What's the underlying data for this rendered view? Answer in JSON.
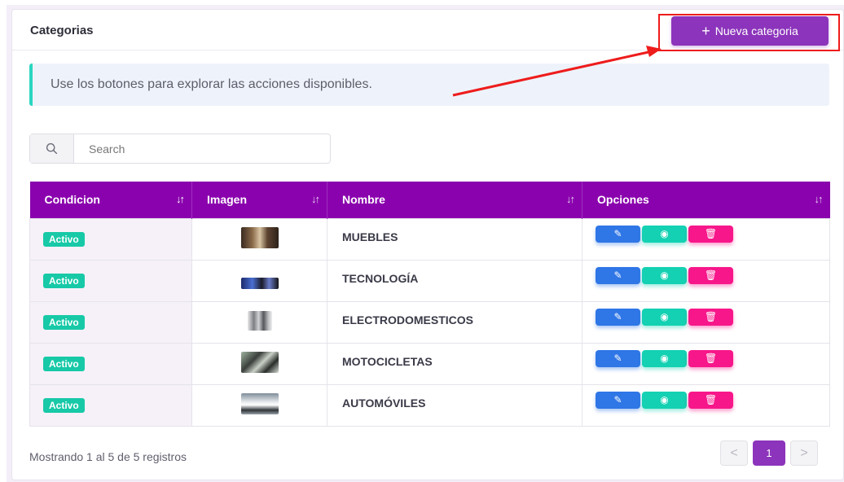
{
  "header": {
    "title": "Categorias",
    "new_button_label": "Nueva categoria",
    "new_button_icon": "plus-icon"
  },
  "alert": {
    "text": "Use los botones para explorar las acciones disponibles."
  },
  "search": {
    "placeholder": "Search",
    "icon": "search-icon"
  },
  "table": {
    "columns": [
      "Condicion",
      "Imagen",
      "Nombre",
      "Opciones"
    ],
    "rows": [
      {
        "status": "Activo",
        "name": "MUEBLES",
        "image": "furniture-thumbnail"
      },
      {
        "status": "Activo",
        "name": "TECNOLOGÍA",
        "image": "technology-thumbnail"
      },
      {
        "status": "Activo",
        "name": "ELECTRODOMESTICOS",
        "image": "appliances-thumbnail"
      },
      {
        "status": "Activo",
        "name": "MOTOCICLETAS",
        "image": "motorcycles-thumbnail"
      },
      {
        "status": "Activo",
        "name": "AUTOMÓVILES",
        "image": "cars-thumbnail"
      }
    ],
    "option_icons": [
      "edit-icon",
      "eye-icon",
      "trash-icon"
    ]
  },
  "footer": {
    "info": "Mostrando 1 al 5 de 5 registros",
    "prev": "<",
    "current_page": "1",
    "next": ">"
  },
  "colors": {
    "primary": "#8c34bb",
    "header_bg": "#8a02ad",
    "status_badge": "#17c9a7",
    "edit": "#2f76e6",
    "view": "#13d1b2",
    "delete": "#f7178a",
    "annotation": "#ee1c1c"
  }
}
